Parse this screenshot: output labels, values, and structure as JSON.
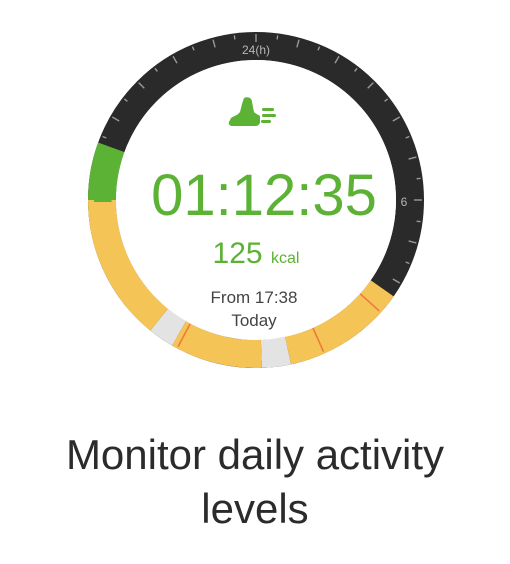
{
  "watch": {
    "bezel_top_label": "24(h)",
    "bezel_right_label": "6",
    "activity_icon": "running-shoe-icon",
    "duration": "01:12:35",
    "calories_value": "125",
    "calories_unit": "kcal",
    "start_time": "From 17:38",
    "day": "Today",
    "colors": {
      "accent_green": "#5cb234",
      "bezel_dark": "#2a2a2a",
      "activity_yellow": "#f4c456",
      "idle_gray": "#e3e3e3",
      "marker_orange": "#f07a3a",
      "text_dark": "#444444"
    }
  },
  "caption": {
    "line1": "Monitor daily activity",
    "line2": "levels"
  }
}
